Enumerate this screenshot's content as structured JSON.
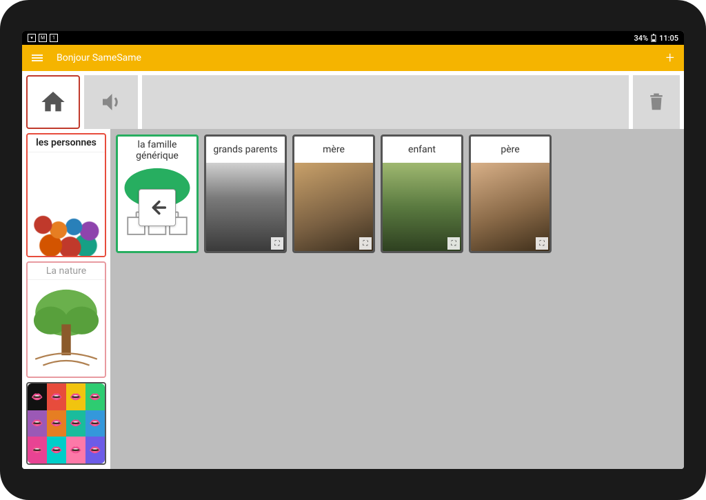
{
  "status": {
    "battery": "34%",
    "time": "11:05"
  },
  "appbar": {
    "title": "Bonjour SameSame"
  },
  "sidebar": {
    "items": [
      {
        "label": "les personnes",
        "state": "active",
        "icon": "crowd"
      },
      {
        "label": "La nature",
        "state": "inactive",
        "icon": "tree"
      },
      {
        "label": "",
        "state": "normal",
        "icon": "popart"
      }
    ]
  },
  "cards": [
    {
      "label": "la famille générique",
      "type": "back"
    },
    {
      "label": "grands parents",
      "type": "photo-bw"
    },
    {
      "label": "mère",
      "type": "photo-warm"
    },
    {
      "label": "enfant",
      "type": "photo-kid"
    },
    {
      "label": "père",
      "type": "photo-warm"
    }
  ],
  "icons": {
    "home": "home-icon",
    "speaker": "speaker-icon",
    "trash": "trash-icon",
    "menu": "menu-icon",
    "add": "add-icon",
    "back": "back-arrow-icon",
    "expand": "expand-icon"
  }
}
